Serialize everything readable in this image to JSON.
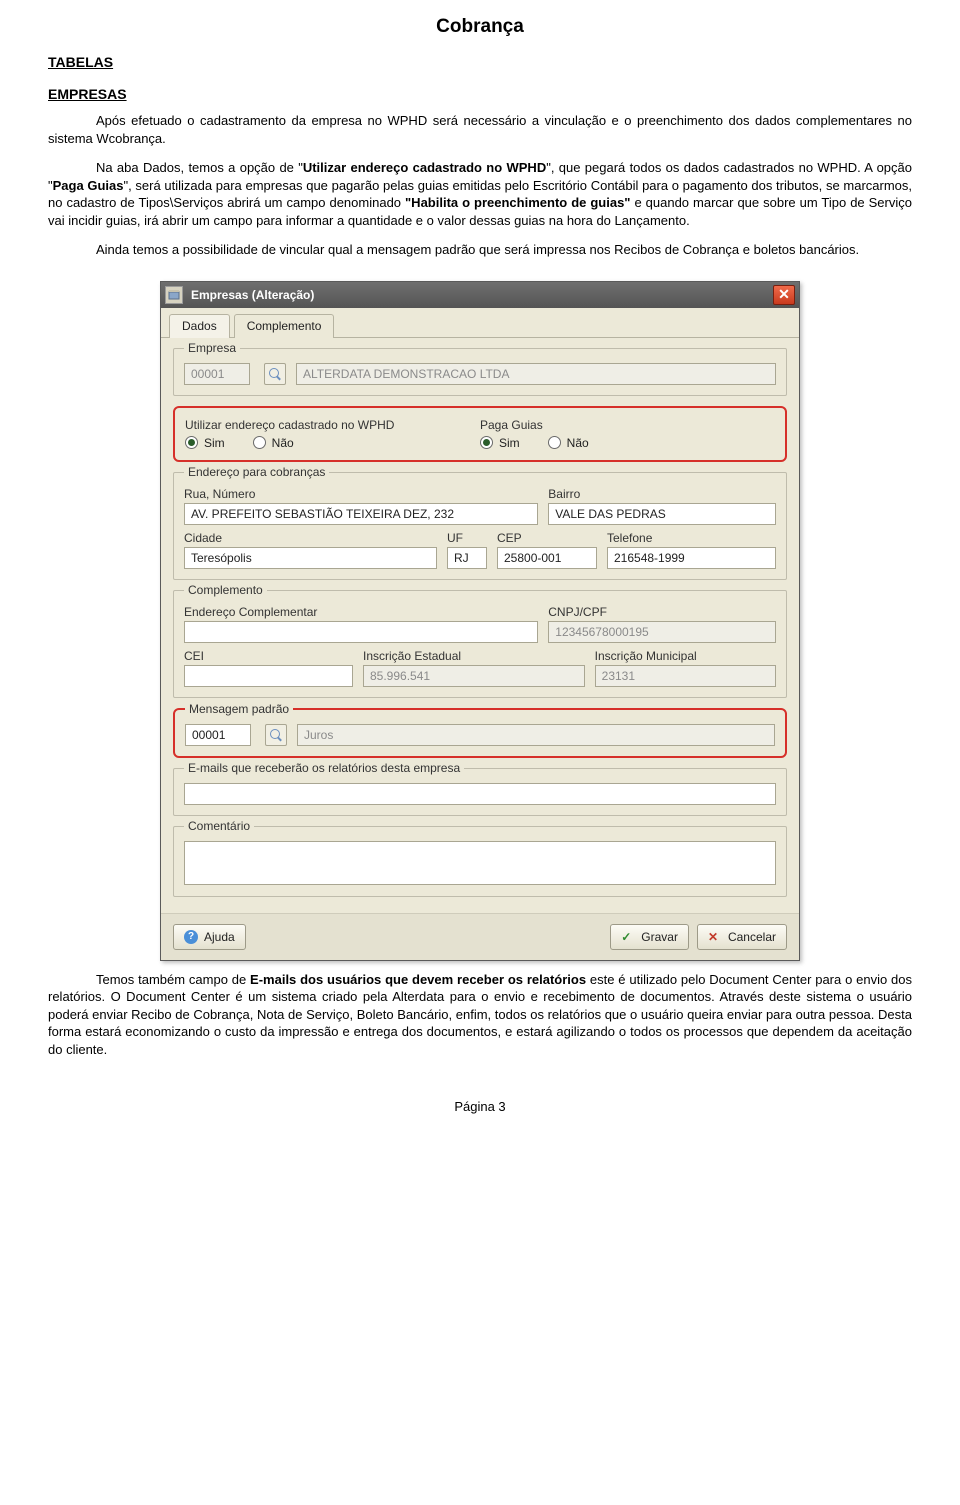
{
  "page": {
    "title": "Cobrança",
    "h_tabelas": "TABELAS",
    "h_empresas": "EMPRESAS",
    "para1": "Após efetuado o cadastramento da empresa no WPHD será necessário a vinculação e o preenchimento dos dados complementares no sistema Wcobrança.",
    "para2_a": "Na aba Dados, temos a opção de \"",
    "para2_b1": "Utilizar endereço cadastrado no WPHD",
    "para2_c": "\", que pegará todos os dados cadastrados no WPHD. A opção \"",
    "para2_b2": "Paga Guias",
    "para2_d": "\", será utilizada para empresas que pagarão pelas guias emitidas pelo Escritório Contábil para o pagamento dos tributos, se marcarmos, no cadastro de Tipos\\Serviços abrirá um campo denominado ",
    "para2_b3": "\"Habilita o preenchimento de guias\"",
    "para2_e": " e quando marcar que sobre um Tipo de Serviço vai incidir guias, irá abrir um campo para informar a quantidade e o valor dessas guias na hora do Lançamento.",
    "para3": "Ainda temos a possibilidade de vincular qual a mensagem padrão que será impressa nos Recibos de Cobrança e boletos bancários.",
    "para4_a": "Temos também campo de ",
    "para4_b1": "E-mails dos usuários que devem receber os relatórios",
    "para4_c": " este é utilizado pelo Document Center para o envio dos relatórios. O Document Center é um sistema criado pela Alterdata para o envio e recebimento de documentos. Através deste sistema o usuário poderá enviar Recibo de Cobrança, Nota de Serviço, Boleto Bancário, enfim, todos os relatórios que o usuário queira enviar para outra pessoa. Desta forma estará economizando o custo da impressão e entrega dos documentos, e estará agilizando o todos os processos que dependem da aceitação do cliente.",
    "footer": "Página 3"
  },
  "dialog": {
    "title": "Empresas (Alteração)",
    "tabs": {
      "dados": "Dados",
      "complemento": "Complemento"
    },
    "empresa": {
      "legend": "Empresa",
      "code": "00001",
      "name": "ALTERDATA DEMONSTRACAO LTDA"
    },
    "opts": {
      "left_label": "Utilizar endereço cadastrado no WPHD",
      "right_label": "Paga Guias",
      "sim": "Sim",
      "nao": "Não"
    },
    "endereco": {
      "legend": "Endereço para cobranças",
      "rua_label": "Rua, Número",
      "rua": "AV. PREFEITO SEBASTIÃO TEIXEIRA DEZ, 232",
      "bairro_label": "Bairro",
      "bairro": "VALE DAS PEDRAS",
      "cidade_label": "Cidade",
      "cidade": "Teresópolis",
      "uf_label": "UF",
      "uf": "RJ",
      "cep_label": "CEP",
      "cep": "25800-001",
      "tel_label": "Telefone",
      "tel": "216548-1999"
    },
    "complemento": {
      "legend": "Complemento",
      "end_compl_label": "Endereço Complementar",
      "end_compl": "",
      "cnpj_label": "CNPJ/CPF",
      "cnpj": "12345678000195",
      "cei_label": "CEI",
      "cei": "",
      "ie_label": "Inscrição Estadual",
      "ie": "85.996.541",
      "im_label": "Inscrição Municipal",
      "im": "23131"
    },
    "msg": {
      "legend": "Mensagem padrão",
      "code": "00001",
      "desc": "Juros"
    },
    "emails": {
      "legend": "E-mails que receberão os relatórios desta empresa",
      "value": ""
    },
    "comentario": {
      "legend": "Comentário",
      "value": ""
    },
    "buttons": {
      "ajuda": "Ajuda",
      "gravar": "Gravar",
      "cancelar": "Cancelar"
    }
  }
}
